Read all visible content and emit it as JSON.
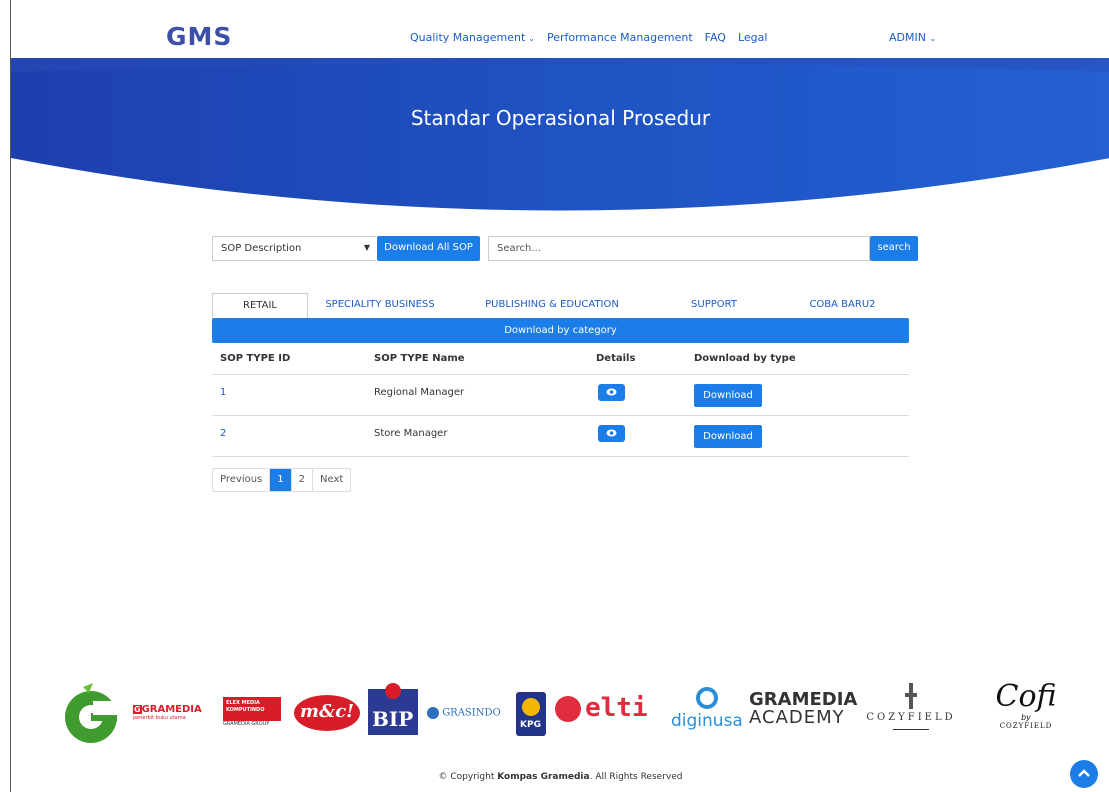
{
  "header": {
    "logo": "GMS",
    "nav": [
      {
        "label": "Quality Management",
        "dropdown": true
      },
      {
        "label": "Performance Management",
        "dropdown": false
      },
      {
        "label": "FAQ",
        "dropdown": false
      },
      {
        "label": "Legal",
        "dropdown": false
      }
    ],
    "user_menu": "ADMIN"
  },
  "banner": {
    "title": "Standar Operasional Prosedur",
    "color": "#1e55c4"
  },
  "toolbar": {
    "select_value": "SOP Description",
    "download_all_label": "Download All SOP",
    "search_placeholder": "Search...",
    "search_label": "search"
  },
  "tabs": [
    {
      "label": "RETAIL",
      "active": true
    },
    {
      "label": "SPECIALITY BUSINESS",
      "active": false
    },
    {
      "label": "PUBLISHING & EDUCATION",
      "active": false
    },
    {
      "label": "SUPPORT",
      "active": false
    },
    {
      "label": "COBA BARU2",
      "active": false
    }
  ],
  "category_bar": "Download by category",
  "table": {
    "columns": [
      "SOP TYPE ID",
      "SOP TYPE Name",
      "Details",
      "Download by type"
    ],
    "rows": [
      {
        "id": "1",
        "name": "Regional Manager",
        "download": "Download"
      },
      {
        "id": "2",
        "name": "Store Manager",
        "download": "Download"
      }
    ]
  },
  "pagination": {
    "previous": "Previous",
    "pages": [
      "1",
      "2"
    ],
    "current": "1",
    "next": "Next"
  },
  "footer": {
    "logos": {
      "gramedia": "GRAMEDIA",
      "gramedia_sub": "penerbit buku utama",
      "elex": "ELEX MEDIA KOMPUTINDO",
      "elex_sub": "GRAMEDIA GROUP",
      "mc": "m&c!",
      "bip": "BIP",
      "grasindo": "GRASINDO",
      "kpg": "KPG",
      "elti": "elti",
      "diginusa": "diginusa",
      "gramedia_academy_1": "GRAMEDIA",
      "gramedia_academy_2": "ACADEMY",
      "cozyfield": "COZYFIELD",
      "cofi": "Cofi",
      "cofi_by": "by",
      "cofi_sub": "COZYFIELD"
    },
    "copyright_prefix": "© Copyright ",
    "copyright_brand": "Kompas Gramedia",
    "copyright_suffix": ". All Rights Reserved"
  },
  "colors": {
    "accent": "#1b7ee8",
    "link": "#1a5dc8",
    "logo": "#3d4fa6"
  },
  "icons": {
    "details": "eye-icon",
    "back_to_top": "chevron-up-icon",
    "nav_dropdown": "chevron-down-icon",
    "select_arrow": "caret-down-icon"
  }
}
